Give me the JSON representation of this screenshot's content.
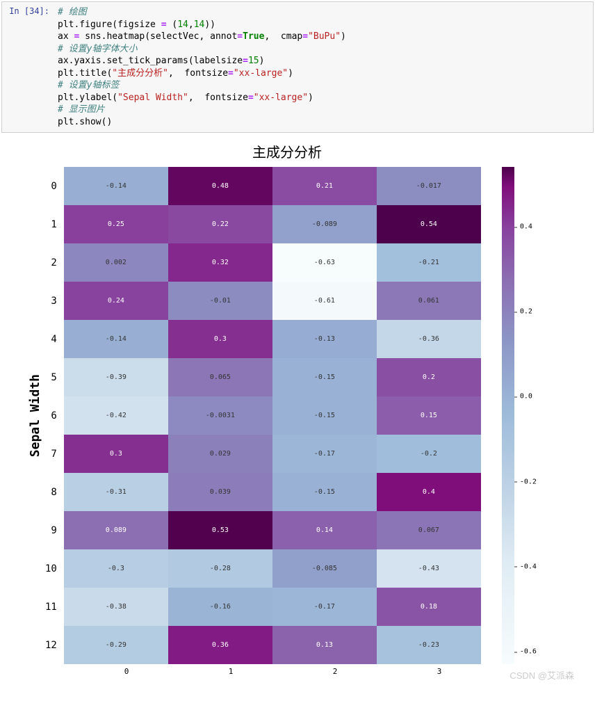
{
  "prompt": "In  [34]:",
  "code": {
    "l1": "# 绘图",
    "l2a": "plt.figure(figsize ",
    "l2b": " (",
    "l2c": "14",
    "l2d": ",",
    "l2e": "14",
    "l2f": "))",
    "l3a": "ax ",
    "l3b": " sns.heatmap(selectVec, annot",
    "l3c": "True",
    "l3d": ",  cmap",
    "l3e": "\"BuPu\"",
    "l3f": ")",
    "l4": "# 设置y轴字体大小",
    "l5a": "ax.yaxis.set_tick_params(labelsize",
    "l5b": "15",
    "l5c": ")",
    "l6a": "plt.title(",
    "l6b": "\"主成分分析\"",
    "l6c": ",  fontsize",
    "l6d": "\"xx-large\"",
    "l6e": ")",
    "l7": "# 设置y轴标签",
    "l8a": "plt.ylabel(",
    "l8b": "\"Sepal Width\"",
    "l8c": ",  fontsize",
    "l8d": "\"xx-large\"",
    "l8e": ")",
    "l9": "# 显示图片",
    "l10": "plt.show()"
  },
  "chart_data": {
    "type": "heatmap",
    "title": "主成分分析",
    "ylabel": "Sepal Width",
    "xlabel": "",
    "x_categories": [
      "0",
      "1",
      "2",
      "3"
    ],
    "y_categories": [
      "0",
      "1",
      "2",
      "3",
      "4",
      "5",
      "6",
      "7",
      "8",
      "9",
      "10",
      "11",
      "12"
    ],
    "colorbar_ticks": [
      "0.4",
      "0.2",
      "0.0",
      "-0.2",
      "-0.4",
      "-0.6"
    ],
    "values": [
      [
        -0.14,
        0.48,
        0.21,
        -0.017
      ],
      [
        0.25,
        0.22,
        -0.089,
        0.54
      ],
      [
        0.002,
        0.32,
        -0.63,
        -0.21
      ],
      [
        0.24,
        -0.01,
        -0.61,
        0.061
      ],
      [
        -0.14,
        0.3,
        -0.13,
        -0.36
      ],
      [
        -0.39,
        0.065,
        -0.15,
        0.2
      ],
      [
        -0.42,
        -0.0031,
        -0.15,
        0.15
      ],
      [
        0.3,
        0.029,
        -0.17,
        -0.2
      ],
      [
        -0.31,
        0.039,
        -0.15,
        0.4
      ],
      [
        0.089,
        0.53,
        0.14,
        0.067
      ],
      [
        -0.3,
        -0.28,
        -0.085,
        -0.43
      ],
      [
        -0.38,
        -0.16,
        -0.17,
        0.18
      ],
      [
        -0.29,
        0.36,
        0.13,
        -0.23
      ]
    ],
    "cmap": "BuPu",
    "vmin": -0.63,
    "vmax": 0.54
  },
  "watermark": "CSDN @艾派森"
}
